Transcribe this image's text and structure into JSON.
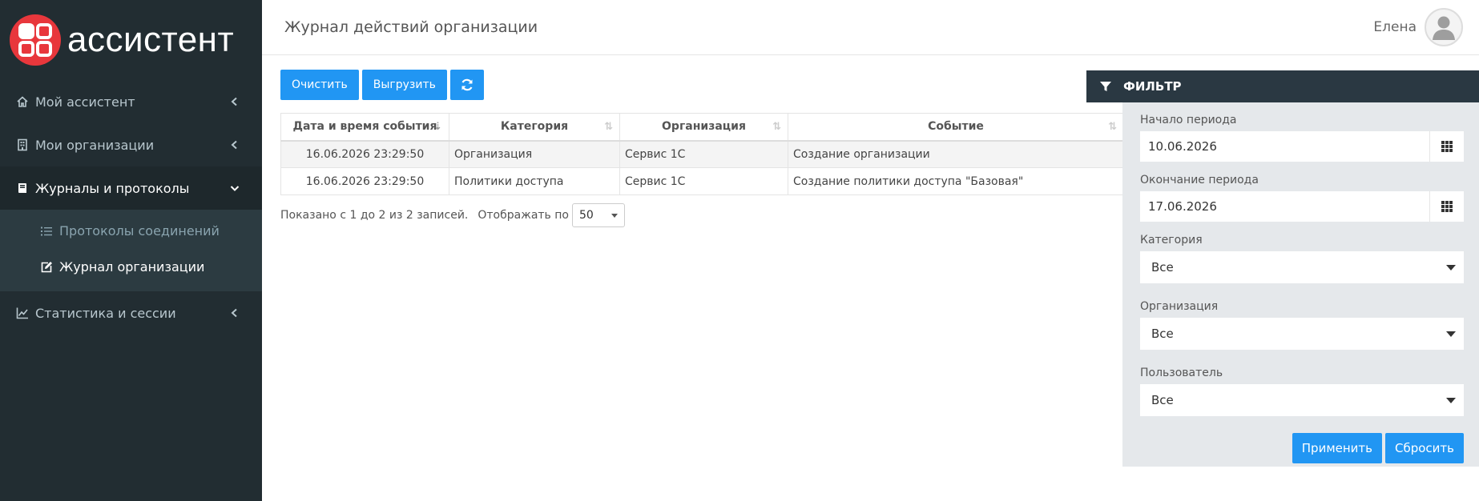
{
  "brand": {
    "name": "ассистент"
  },
  "sidebar": {
    "items": [
      {
        "label": "Мой ассистент",
        "icon": "home-icon"
      },
      {
        "label": "Мои организации",
        "icon": "building-icon"
      },
      {
        "label": "Журналы и протоколы",
        "icon": "book-icon",
        "expanded": true,
        "children": [
          {
            "label": "Протоколы соединений",
            "icon": "list-icon"
          },
          {
            "label": "Журнал организации",
            "icon": "edit-icon",
            "current": true
          }
        ]
      },
      {
        "label": "Статистика и сессии",
        "icon": "line-chart-icon"
      }
    ]
  },
  "header": {
    "title": "Журнал действий организации",
    "user": "Елена"
  },
  "toolbar": {
    "clear_label": "Очистить",
    "export_label": "Выгрузить",
    "refresh_icon": "refresh-icon"
  },
  "table": {
    "columns": [
      "Дата и время события",
      "Категория",
      "Организация",
      "Событие"
    ],
    "rows": [
      [
        "16.06.2026 23:29:50",
        "Организация",
        "Сервис 1С",
        "Создание организации"
      ],
      [
        "16.06.2026 23:29:50",
        "Политики доступа",
        "Сервис 1С",
        "Создание политики доступа \"Базовая\""
      ]
    ],
    "info": "Показано с 1 до 2 из 2 записей.",
    "page_size_label": "Отображать по",
    "page_size": "50"
  },
  "filter": {
    "title": "ФИЛЬТР",
    "start_label": "Начало периода",
    "start_value": "10.06.2026",
    "end_label": "Окончание периода",
    "end_value": "17.06.2026",
    "category_label": "Категория",
    "category_value": "Все",
    "org_label": "Организация",
    "org_value": "Все",
    "user_label": "Пользователь",
    "user_value": "Все",
    "apply_label": "Применить",
    "reset_label": "Сбросить"
  },
  "colors": {
    "sidebar_bg": "#222d32",
    "accent": "#2196f3",
    "brand_red": "#e8373c",
    "filter_head": "#2a3842"
  }
}
